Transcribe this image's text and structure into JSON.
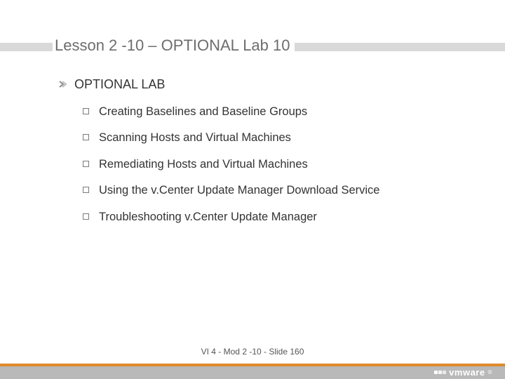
{
  "title": "Lesson 2 -10 – OPTIONAL Lab 10",
  "section_heading": "OPTIONAL LAB",
  "items": [
    "Creating Baselines and Baseline Groups",
    "Scanning Hosts and Virtual Machines",
    "Remediating Hosts and Virtual Machines",
    "Using the v.Center Update Manager Download Service",
    "Troubleshooting v.Center Update Manager"
  ],
  "footer": "VI 4 - Mod 2 -10 - Slide 160",
  "logo_text": "vmware",
  "colors": {
    "accent": "#e08a2c",
    "stripe": "#d9d9d9",
    "footer_gray": "#b9b9b9"
  }
}
